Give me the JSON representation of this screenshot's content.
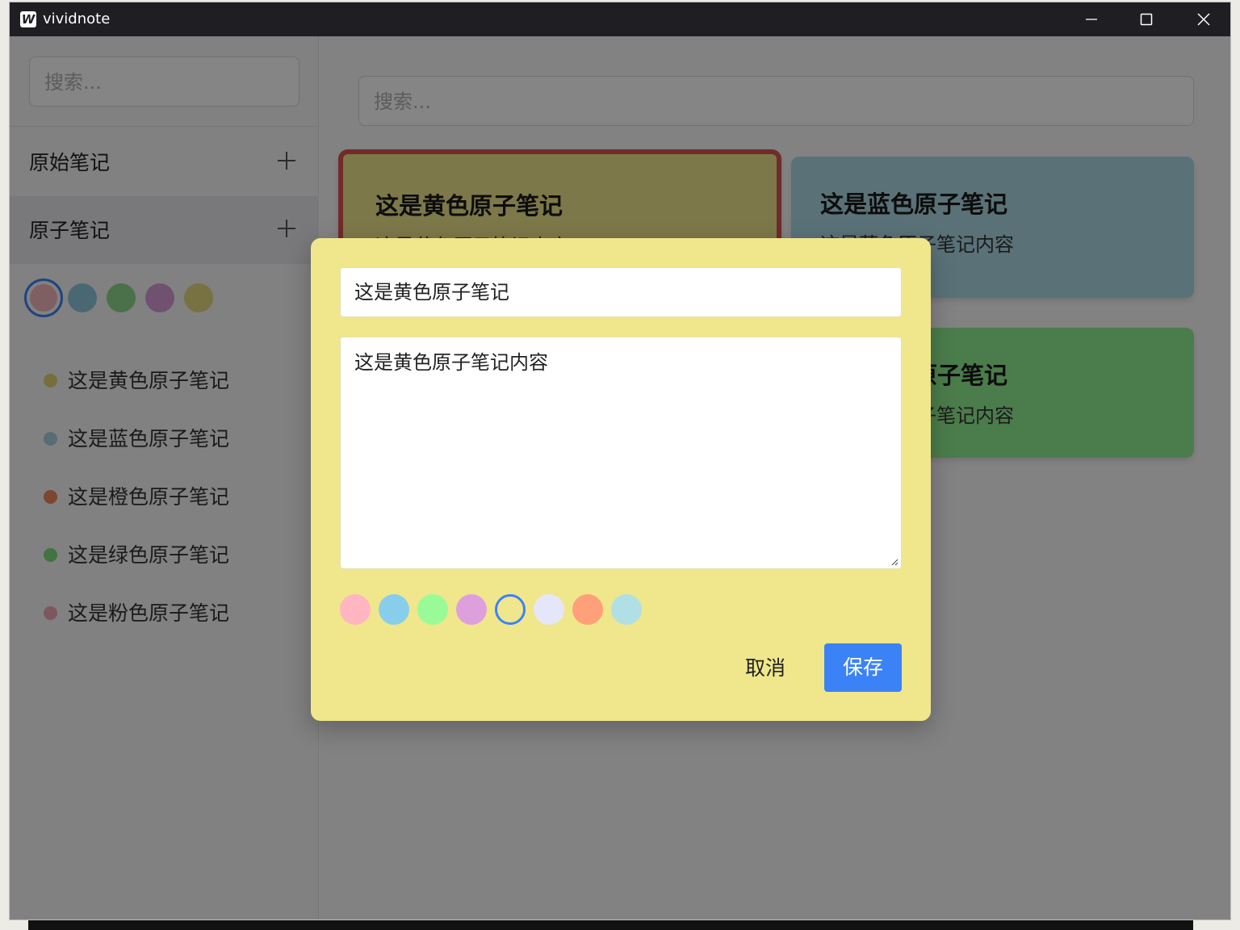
{
  "window": {
    "title": "vividnote",
    "app_icon_letter": "W"
  },
  "sidebar": {
    "search_placeholder": "搜索...",
    "sections": [
      {
        "label": "原始笔记",
        "add_icon": "plus-icon"
      },
      {
        "label": "原子笔记",
        "add_icon": "plus-icon"
      }
    ],
    "filter_colors": [
      {
        "name": "pink",
        "color": "#f3b6bb",
        "selected": true
      },
      {
        "name": "blue",
        "color": "#8fc8dc",
        "selected": false
      },
      {
        "name": "green",
        "color": "#8fd98f",
        "selected": false
      },
      {
        "name": "purple",
        "color": "#d69bd6",
        "selected": false
      },
      {
        "name": "yellow",
        "color": "#e6d97e",
        "selected": false
      }
    ],
    "notes": [
      {
        "title": "这是黄色原子笔记",
        "color": "#e0d47a"
      },
      {
        "title": "这是蓝色原子笔记",
        "color": "#a9cfdd"
      },
      {
        "title": "这是橙色原子笔记",
        "color": "#f0865a"
      },
      {
        "title": "这是绿色原子笔记",
        "color": "#7fdc7f"
      },
      {
        "title": "这是粉色原子笔记",
        "color": "#f0a7b5"
      }
    ]
  },
  "main": {
    "search_placeholder": "搜索...",
    "cards": [
      {
        "title": "这是黄色原子笔记",
        "body": "这是黄色原子笔记内容",
        "color": "#f0e68c"
      },
      {
        "title": "这是蓝色原子笔记",
        "body": "这是蓝色原子笔记内容",
        "color": "#add8e6"
      },
      {
        "title": "这是绿色原子笔记",
        "body": "这是绿色原子笔记内容",
        "color": "#90ee90"
      }
    ]
  },
  "modal": {
    "title_value": "这是黄色原子笔记",
    "content_value": "这是黄色原子笔记内容",
    "background": "#f0e68c",
    "colors": [
      {
        "name": "pink",
        "color": "#ffb6c1",
        "selected": false
      },
      {
        "name": "skyblue",
        "color": "#87ceeb",
        "selected": false
      },
      {
        "name": "palegreen",
        "color": "#98fb98",
        "selected": false
      },
      {
        "name": "plum",
        "color": "#dda0dd",
        "selected": false
      },
      {
        "name": "khaki",
        "color": "#f0e68c",
        "selected": true
      },
      {
        "name": "lavender",
        "color": "#e6e6fa",
        "selected": false
      },
      {
        "name": "lightsalmon",
        "color": "#ffa07a",
        "selected": false
      },
      {
        "name": "powderblue",
        "color": "#b0e0e6",
        "selected": false
      }
    ],
    "cancel_label": "取消",
    "save_label": "保存",
    "accent": "#3b82f6"
  }
}
